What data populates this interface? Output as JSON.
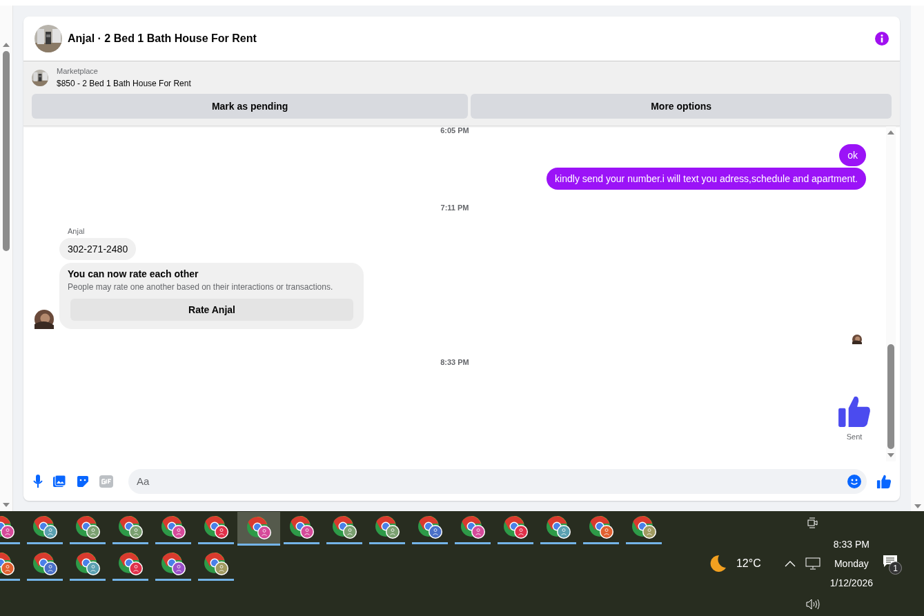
{
  "chat": {
    "title": "Anjal · 2 Bed 1 Bath House For Rent",
    "listing": {
      "label": "Marketplace",
      "price_title": "$850 - 2 Bed 1 Bath House For Rent"
    },
    "actions": [
      "Mark as pending",
      "More options"
    ],
    "messages": [
      {
        "kind": "timestamp",
        "text": "6:05 PM"
      },
      {
        "kind": "outgoing",
        "text": "ok"
      },
      {
        "kind": "outgoing",
        "text": "kindly send your number.i will text you adress,schedule and apartment."
      },
      {
        "kind": "timestamp",
        "text": "7:11 PM"
      },
      {
        "kind": "sender",
        "text": "Anjal"
      },
      {
        "kind": "incoming",
        "text": "302-271-2480"
      },
      {
        "kind": "rating_card",
        "title": "You can now rate each other",
        "text": "People may rate one another based on their interactions or transactions.",
        "button": "Rate Anjal"
      },
      {
        "kind": "read_receipt"
      },
      {
        "kind": "timestamp",
        "text": "8:33 PM"
      },
      {
        "kind": "like",
        "status": "Sent"
      }
    ],
    "composer": {
      "placeholder": "Aa"
    }
  },
  "taskbar": {
    "rows": [
      [
        {
          "color": "#d64a9a",
          "selected": false
        },
        {
          "color": "#5aa0b0",
          "selected": false
        },
        {
          "color": "#7aa070",
          "selected": false
        },
        {
          "color": "#7aa070",
          "selected": false
        },
        {
          "color": "#d64a9a",
          "selected": false
        },
        {
          "color": "#e0304a",
          "selected": false
        },
        {
          "color": "#d64a9a",
          "selected": true
        },
        {
          "color": "#d64a9a",
          "selected": false
        },
        {
          "color": "#7aa070",
          "selected": false
        },
        {
          "color": "#7aa070",
          "selected": false
        },
        {
          "color": "#4a70c8",
          "selected": false
        },
        {
          "color": "#d64a9a",
          "selected": false
        },
        {
          "color": "#e0304a",
          "selected": false
        },
        {
          "color": "#5aa0b0",
          "selected": false
        },
        {
          "color": "#e06030",
          "selected": false
        },
        {
          "color": "#a09a60",
          "selected": false
        }
      ],
      [
        {
          "color": "#e06030",
          "selected": false
        },
        {
          "color": "#4a70c8",
          "selected": false
        },
        {
          "color": "#5aa0b0",
          "selected": false
        },
        {
          "color": "#e0304a",
          "selected": false
        },
        {
          "color": "#9a50c8",
          "selected": false
        },
        {
          "color": "#a09a60",
          "selected": false
        }
      ]
    ],
    "weather": "12°C",
    "time": "8:33 PM",
    "day": "Monday",
    "date": "1/12/2026",
    "notifications": "1"
  }
}
